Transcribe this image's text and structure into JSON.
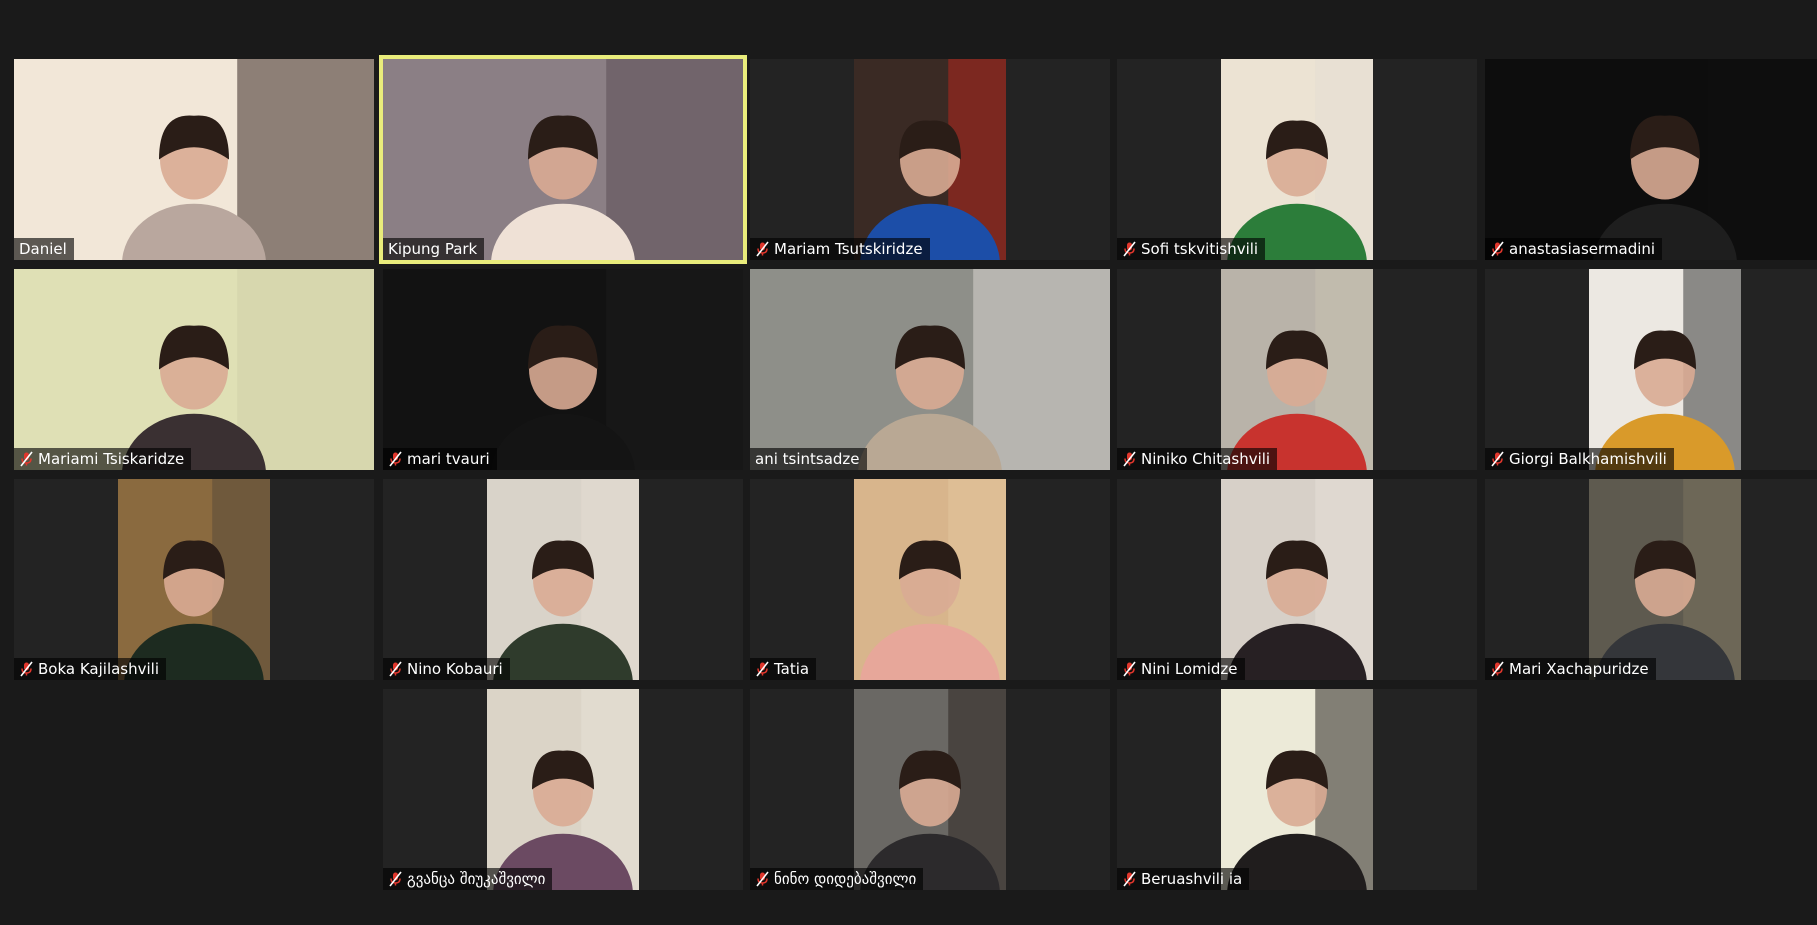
{
  "meeting": {
    "view": "gallery",
    "background_color": "#1a1a1a",
    "active_speaker_color": "#e9ec7b",
    "mute_icon_color": "#e0362c"
  },
  "participants": [
    {
      "name": "Daniel",
      "muted": false,
      "active_speaker": false,
      "feed": "full"
    },
    {
      "name": "Kipung Park",
      "muted": false,
      "active_speaker": true,
      "feed": "full"
    },
    {
      "name": "Mariam Tsutskiridze",
      "muted": true,
      "active_speaker": false,
      "feed": "portrait"
    },
    {
      "name": "Sofi tskvitishvili",
      "muted": true,
      "active_speaker": false,
      "feed": "portrait"
    },
    {
      "name": "anastasiasermadini",
      "muted": true,
      "active_speaker": false,
      "feed": "full"
    },
    {
      "name": "Mariami Tsiskaridze",
      "muted": true,
      "active_speaker": false,
      "feed": "full"
    },
    {
      "name": "mari tvauri",
      "muted": true,
      "active_speaker": false,
      "feed": "full"
    },
    {
      "name": "ani tsintsadze",
      "muted": false,
      "active_speaker": false,
      "feed": "full"
    },
    {
      "name": "Niniko Chitashvili",
      "muted": true,
      "active_speaker": false,
      "feed": "portrait"
    },
    {
      "name": "Giorgi Balkhamishvili",
      "muted": true,
      "active_speaker": false,
      "feed": "portrait"
    },
    {
      "name": "Boka Kajilashvili",
      "muted": true,
      "active_speaker": false,
      "feed": "portrait"
    },
    {
      "name": "Nino Kobauri",
      "muted": true,
      "active_speaker": false,
      "feed": "portrait"
    },
    {
      "name": "Tatia",
      "muted": true,
      "active_speaker": false,
      "feed": "portrait"
    },
    {
      "name": "Nini Lomidze",
      "muted": true,
      "active_speaker": false,
      "feed": "portrait"
    },
    {
      "name": "Mari Xachapuridze",
      "muted": true,
      "active_speaker": false,
      "feed": "portrait"
    },
    {
      "name": "გვანცა შიუკაშვილი",
      "muted": true,
      "active_speaker": false,
      "feed": "portrait"
    },
    {
      "name": "ნინო დიდებაშვილი",
      "muted": true,
      "active_speaker": false,
      "feed": "portrait"
    },
    {
      "name": "Beruashvili ia",
      "muted": true,
      "active_speaker": false,
      "feed": "portrait"
    }
  ]
}
